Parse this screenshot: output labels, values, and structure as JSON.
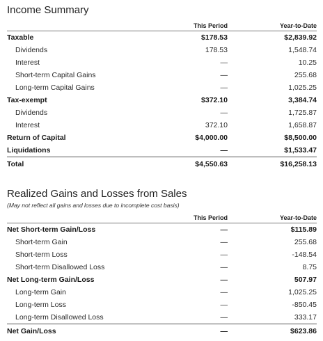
{
  "income": {
    "title": "Income Summary",
    "col_period": "This Period",
    "col_ytd": "Year-to-Date",
    "rows": [
      {
        "label": "Taxable",
        "period": "$178.53",
        "ytd": "$2,839.92",
        "style": "bold"
      },
      {
        "label": "Dividends",
        "period": "178.53",
        "ytd": "1,548.74",
        "style": "sub"
      },
      {
        "label": "Interest",
        "period": "—",
        "ytd": "10.25",
        "style": "sub"
      },
      {
        "label": "Short-term Capital Gains",
        "period": "—",
        "ytd": "255.68",
        "style": "sub"
      },
      {
        "label": "Long-term Capital Gains",
        "period": "—",
        "ytd": "1,025.25",
        "style": "sub"
      },
      {
        "label": "Tax-exempt",
        "period": "$372.10",
        "ytd": "3,384.74",
        "style": "bold"
      },
      {
        "label": "Dividends",
        "period": "—",
        "ytd": "1,725.87",
        "style": "sub"
      },
      {
        "label": "Interest",
        "period": "372.10",
        "ytd": "1,658.87",
        "style": "sub"
      },
      {
        "label": "Return of Capital",
        "period": "$4,000.00",
        "ytd": "$8,500.00",
        "style": "bold"
      },
      {
        "label": "Liquidations",
        "period": "—",
        "ytd": "$1,533.47",
        "style": "bold"
      },
      {
        "label": "Total",
        "period": "$4,550.63",
        "ytd": "$16,258.13",
        "style": "total"
      }
    ]
  },
  "realized": {
    "title": "Realized Gains and Losses from Sales",
    "note": "(May not reflect all gains and losses due to incomplete cost basis)",
    "col_period": "This Period",
    "col_ytd": "Year-to-Date",
    "rows": [
      {
        "label": "Net Short-term Gain/Loss",
        "period": "—",
        "ytd": "$115.89",
        "style": "bold"
      },
      {
        "label": "Short-term Gain",
        "period": "—",
        "ytd": "255.68",
        "style": "sub"
      },
      {
        "label": "Short-term Loss",
        "period": "—",
        "ytd": "-148.54",
        "style": "sub"
      },
      {
        "label": "Short-term Disallowed Loss",
        "period": "—",
        "ytd": "8.75",
        "style": "sub"
      },
      {
        "label": "Net Long-term Gain/Loss",
        "period": "—",
        "ytd": "507.97",
        "style": "bold"
      },
      {
        "label": "Long-term Gain",
        "period": "—",
        "ytd": "1,025.25",
        "style": "sub"
      },
      {
        "label": "Long-term Loss",
        "period": "—",
        "ytd": "-850.45",
        "style": "sub"
      },
      {
        "label": "Long-term Disallowed Loss",
        "period": "—",
        "ytd": "333.17",
        "style": "sub"
      },
      {
        "label": "Net Gain/Loss",
        "period": "—",
        "ytd": "$623.86",
        "style": "total"
      }
    ]
  }
}
